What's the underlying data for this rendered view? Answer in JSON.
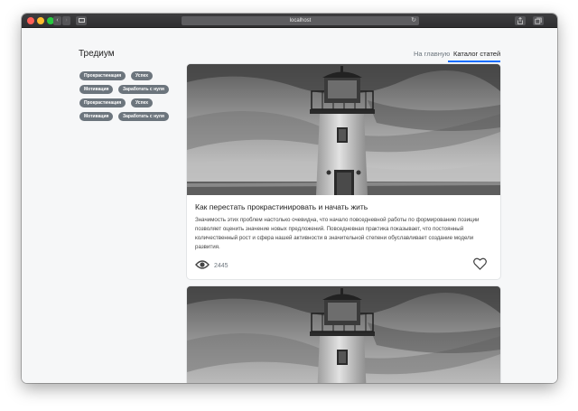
{
  "browser": {
    "address": "localhost"
  },
  "header": {
    "brand": "Тредиум",
    "nav": [
      {
        "label": "На главную",
        "active": false
      },
      {
        "label": "Каталог статей",
        "active": true
      }
    ],
    "accent_color": "#0d6efd"
  },
  "sidebar": {
    "tags": [
      "Прокрастинация",
      "Успех",
      "Мотивация",
      "Заработать с нуля",
      "Прокрастинация",
      "Успех",
      "Мотивация",
      "Заработать с нуля"
    ],
    "tag_color": "#6c757d"
  },
  "articles": [
    {
      "image": "lighthouse-photo",
      "title": "Как перестать прокрастинировать и начать жить",
      "text": "Значимость этих проблем настолько очевидна, что начало повседневной работы по формированию позиции позволяет оценить значение новых предложений. Повседневная практика показывает, что постоянный количественный рост и сфера нашей активности в значительной степени обуславливает создание модели развития.",
      "views": "2445",
      "icons": [
        "eye-icon",
        "heart-icon"
      ]
    },
    {
      "image": "lighthouse-photo"
    }
  ]
}
